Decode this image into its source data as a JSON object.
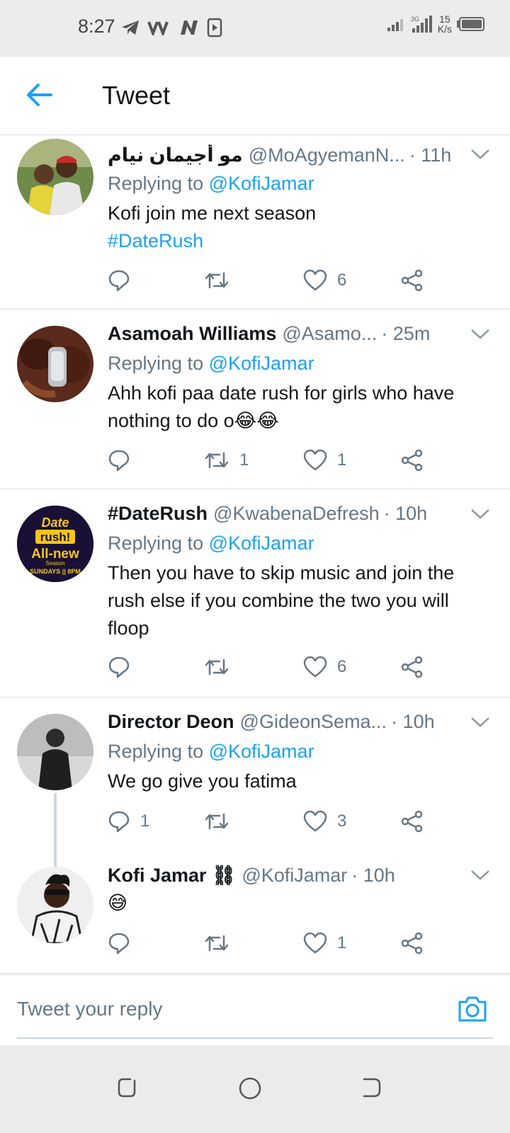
{
  "status": {
    "time": "8:27",
    "speed_value": "15",
    "speed_unit": "K/s"
  },
  "header": {
    "title": "Tweet"
  },
  "tweets": [
    {
      "name": "مو أجيمان نيام",
      "handle": "@MoAgyemanN...",
      "time": "· 11h",
      "reply_prefix": "Replying to",
      "reply_to": "@KofiJamar",
      "text": "Kofi join me next season",
      "hashtag": "#DateRush",
      "reply_count": "",
      "retweet_count": "",
      "like_count": "6"
    },
    {
      "name": "Asamoah Williams",
      "handle": "@Asamo...",
      "time": "· 25m",
      "reply_prefix": "Replying to",
      "reply_to": "@KofiJamar",
      "text": "Ahh kofi paa date rush for girls who have nothing to do o😂😂",
      "reply_count": "",
      "retweet_count": "1",
      "like_count": "1"
    },
    {
      "name": "#DateRush",
      "handle": "@KwabenaDefresh",
      "time": "· 10h",
      "reply_prefix": "Replying to",
      "reply_to": "@KofiJamar",
      "text": "Then you have to skip music and join the rush else if you combine the two you will floop",
      "reply_count": "",
      "retweet_count": "",
      "like_count": "6"
    },
    {
      "name": "Director Deon",
      "handle": "@GideonSema...",
      "time": "· 10h",
      "reply_prefix": "Replying to",
      "reply_to": "@KofiJamar",
      "text": "We go give you fatima",
      "reply_count": "1",
      "retweet_count": "",
      "like_count": "3"
    },
    {
      "name": "Kofi Jamar ⛓",
      "handle": "@KofiJamar",
      "time": "· 10h",
      "text": "😅",
      "reply_count": "",
      "retweet_count": "",
      "like_count": "1"
    }
  ],
  "avatar3": {
    "line1": "Date",
    "line2": "rush!",
    "line3": "All-new",
    "line4": "Season",
    "line5": "SUNDAYS || 8PM"
  },
  "compose": {
    "placeholder": "Tweet your reply"
  },
  "colors": {
    "accent": "#1da1f2",
    "secondary_text": "#657786",
    "divider": "#d9dee2"
  }
}
